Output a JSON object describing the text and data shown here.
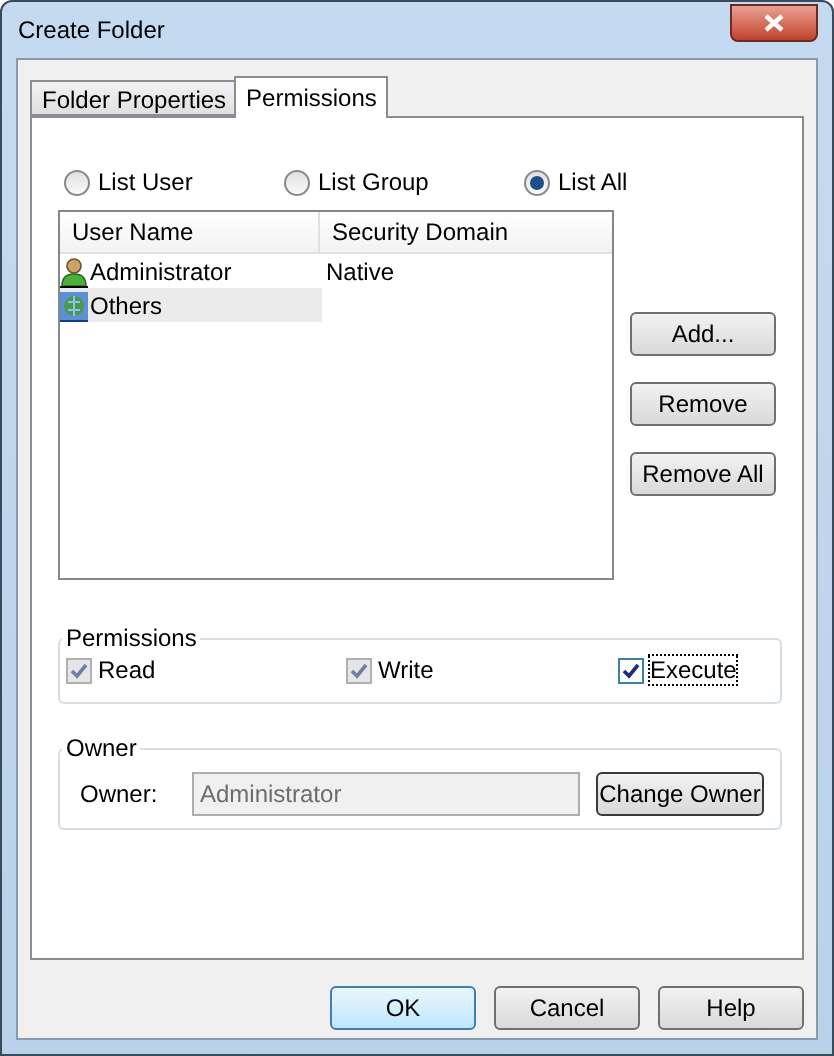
{
  "window": {
    "title": "Create Folder"
  },
  "tabs": [
    {
      "label": "Folder Properties",
      "selected": false
    },
    {
      "label": "Permissions",
      "selected": true
    }
  ],
  "list_filter": [
    {
      "label": "List User",
      "selected": false
    },
    {
      "label": "List Group",
      "selected": false
    },
    {
      "label": "List All",
      "selected": true
    }
  ],
  "table": {
    "columns": [
      "User Name",
      "Security Domain"
    ],
    "rows": [
      {
        "kind": "user",
        "name": "Administrator",
        "domain": "Native",
        "selected": false
      },
      {
        "kind": "group",
        "name": "Others",
        "selected": true
      }
    ]
  },
  "list_buttons": [
    "Add...",
    "Remove",
    "Remove All"
  ],
  "permissions": {
    "title": "Permissions",
    "items": [
      {
        "label": "Read",
        "checked": true,
        "disabled": true,
        "focused": false
      },
      {
        "label": "Write",
        "checked": true,
        "disabled": true,
        "focused": false
      },
      {
        "label": "Execute",
        "checked": true,
        "disabled": false,
        "focused": true
      }
    ]
  },
  "owner": {
    "title": "Owner",
    "label": "Owner:",
    "value": "Administrator",
    "disabled": true,
    "button": "Change Owner"
  },
  "buttons": [
    {
      "label": "OK",
      "default": true
    },
    {
      "label": "Cancel",
      "default": false
    },
    {
      "label": "Help",
      "default": false
    }
  ]
}
